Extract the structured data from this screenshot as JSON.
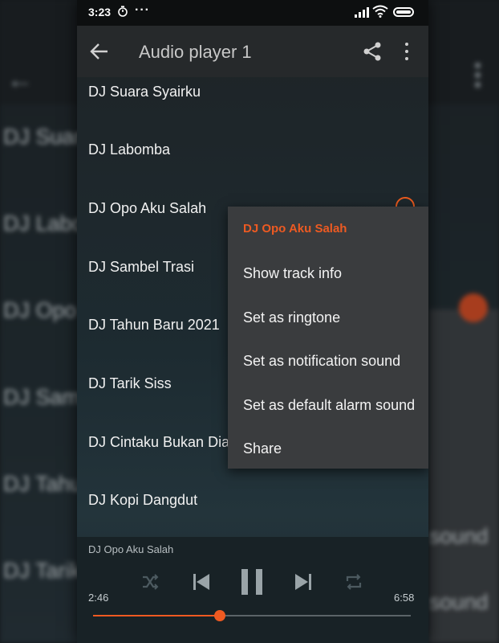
{
  "status_bar": {
    "time": "3:23",
    "more": "···"
  },
  "app_bar": {
    "title": "Audio player 1"
  },
  "tracks": [
    "DJ Suara Syairku",
    "DJ Labomba",
    "DJ Opo Aku Salah",
    "DJ Sambel Trasi",
    "DJ Tahun Baru 2021",
    "DJ Tarik Siss",
    "DJ Cintaku Bukan Dia",
    "DJ Kopi Dangdut"
  ],
  "context_menu": {
    "title": "DJ Opo Aku Salah",
    "items": [
      "Show track info",
      "Set as ringtone",
      "Set as notification sound",
      "Set as default alarm sound",
      "Share"
    ]
  },
  "player": {
    "now_playing": "DJ Opo Aku Salah",
    "elapsed": "2:46",
    "duration": "6:58",
    "progress_fraction": 0.4
  },
  "background": {
    "items": [
      "DJ Suara",
      "DJ Labo",
      "DJ Opo",
      "DJ Sam",
      "DJ Tahu",
      "DJ Tarik"
    ],
    "right_texts": [
      "sound",
      "sound"
    ]
  },
  "colors": {
    "accent": "#ef5a21",
    "app_bar": "#26292b",
    "menu_background": "#3a3c3e",
    "text_primary": "#f1f1f1"
  },
  "icons": [
    "back-arrow-icon",
    "share-icon",
    "more-vert-icon",
    "timer-icon",
    "signal-icon",
    "wifi-icon",
    "battery-icon",
    "play-circle-icon",
    "shuffle-icon",
    "previous-icon",
    "pause-icon",
    "next-icon",
    "repeat-icon"
  ]
}
